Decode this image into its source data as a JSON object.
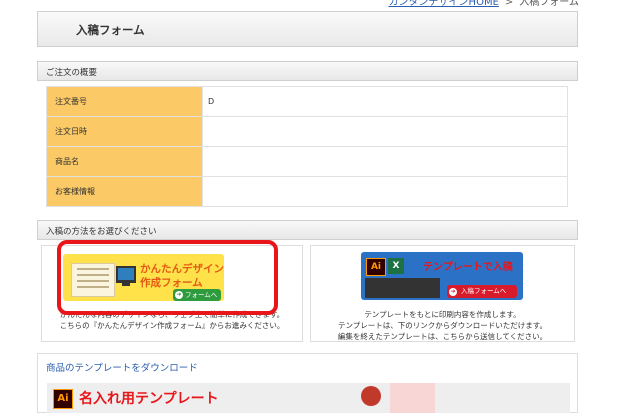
{
  "breadcrumb": {
    "home": "カンタンデザインHOME",
    "sep": ">",
    "current": "入稿フォーム"
  },
  "page": {
    "title": "入稿フォーム"
  },
  "summary": {
    "heading": "ご注文の概要",
    "rows": [
      {
        "label": "注文番号",
        "value": "D"
      },
      {
        "label": "注文日時",
        "value": ""
      },
      {
        "label": "商品名",
        "value": ""
      },
      {
        "label": "お客様情報",
        "value": ""
      }
    ]
  },
  "method": {
    "heading": "入稿の方法をお選びください",
    "simple": {
      "title1": "かんたんデザイン",
      "title2": "作成フォーム",
      "button": "フォームへ",
      "desc1": "かんたんな内容のデザインなら、ウェブ上で簡単に作成できます。",
      "desc2": "こちらの『かんたんデザイン作成フォーム』からお進みください。"
    },
    "template": {
      "title": "テンプレートで入稿",
      "button": "入稿フォームへ",
      "ai": "Ai",
      "excel": "X",
      "desc1": "テンプレートをもとに印刷内容を作成します。",
      "desc2": "テンプレートは、下のリンクからダウンロードいただけます。",
      "desc3": "編集を終えたテンプレートは、こちらから送信してください。"
    }
  },
  "download": {
    "heading": "商品のテンプレートをダウンロード",
    "ai": "Ai",
    "banner": "名入れ用テンプレート"
  },
  "colors": {
    "label_bg": "#fbc966",
    "highlight": "#e8161b",
    "link": "#2a5db0"
  }
}
